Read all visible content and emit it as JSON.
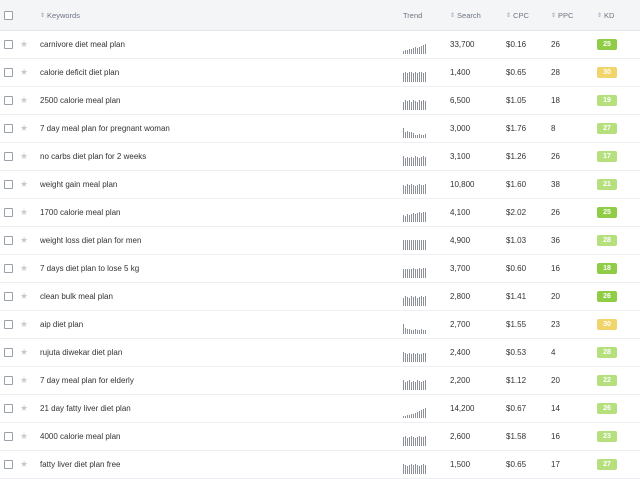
{
  "header": {
    "keywords": "Keywords",
    "trend": "Trend",
    "search": "Search",
    "cpc": "CPC",
    "ppc": "PPC",
    "kd": "KD"
  },
  "rows": [
    {
      "keyword": "carnivore diet meal plan",
      "search": "33,700",
      "cpc": "$0.16",
      "ppc": "26",
      "kd": "25",
      "kd_class": "easy",
      "trend": [
        3,
        4,
        4,
        5,
        5,
        6,
        7,
        6,
        7,
        8,
        9,
        10
      ]
    },
    {
      "keyword": "calorie deficit diet plan",
      "search": "1,400",
      "cpc": "$0.65",
      "ppc": "28",
      "kd": "30",
      "kd_class": "mid",
      "trend": [
        9,
        10,
        9,
        10,
        10,
        9,
        10,
        9,
        10,
        10,
        9,
        10
      ]
    },
    {
      "keyword": "2500 calorie meal plan",
      "search": "6,500",
      "cpc": "$1.05",
      "ppc": "18",
      "kd": "19",
      "kd_class": "light",
      "trend": [
        8,
        10,
        9,
        10,
        8,
        10,
        9,
        8,
        10,
        9,
        10,
        9
      ]
    },
    {
      "keyword": "7 day meal plan for pregnant woman",
      "search": "3,000",
      "cpc": "$1.76",
      "ppc": "8",
      "kd": "27",
      "kd_class": "light",
      "trend": [
        10,
        6,
        7,
        6,
        6,
        5,
        3,
        3,
        4,
        3,
        3,
        4
      ]
    },
    {
      "keyword": "no carbs diet plan for 2 weeks",
      "search": "3,100",
      "cpc": "$1.26",
      "ppc": "26",
      "kd": "17",
      "kd_class": "light",
      "trend": [
        10,
        8,
        9,
        8,
        9,
        8,
        10,
        9,
        8,
        9,
        10,
        9
      ]
    },
    {
      "keyword": "weight gain meal plan",
      "search": "10,800",
      "cpc": "$1.60",
      "ppc": "38",
      "kd": "21",
      "kd_class": "light",
      "trend": [
        9,
        8,
        10,
        9,
        10,
        9,
        8,
        9,
        10,
        9,
        9,
        10
      ]
    },
    {
      "keyword": "1700 calorie meal plan",
      "search": "4,100",
      "cpc": "$2.02",
      "ppc": "26",
      "kd": "25",
      "kd_class": "easy",
      "trend": [
        7,
        6,
        8,
        7,
        8,
        9,
        8,
        9,
        10,
        9,
        10,
        10
      ]
    },
    {
      "keyword": "weight loss diet plan for men",
      "search": "4,900",
      "cpc": "$1.03",
      "ppc": "36",
      "kd": "28",
      "kd_class": "light",
      "trend": [
        10,
        10,
        10,
        10,
        10,
        10,
        10,
        10,
        10,
        10,
        10,
        10
      ]
    },
    {
      "keyword": "7 days diet plan to lose 5 kg",
      "search": "3,700",
      "cpc": "$0.60",
      "ppc": "16",
      "kd": "18",
      "kd_class": "easy",
      "trend": [
        9,
        9,
        9,
        9,
        9,
        10,
        9,
        9,
        10,
        9,
        10,
        10
      ]
    },
    {
      "keyword": "clean bulk meal plan",
      "search": "2,800",
      "cpc": "$1.41",
      "ppc": "20",
      "kd": "26",
      "kd_class": "easy",
      "trend": [
        8,
        10,
        9,
        8,
        10,
        9,
        10,
        8,
        9,
        10,
        9,
        10
      ]
    },
    {
      "keyword": "aip diet plan",
      "search": "2,700",
      "cpc": "$1.55",
      "ppc": "23",
      "kd": "30",
      "kd_class": "mid",
      "trend": [
        10,
        6,
        5,
        5,
        4,
        4,
        5,
        4,
        4,
        5,
        4,
        4
      ]
    },
    {
      "keyword": "rujuta diwekar diet plan",
      "search": "2,400",
      "cpc": "$0.53",
      "ppc": "4",
      "kd": "28",
      "kd_class": "light",
      "trend": [
        10,
        9,
        8,
        9,
        8,
        9,
        8,
        9,
        8,
        8,
        9,
        9
      ]
    },
    {
      "keyword": "7 day meal plan for elderly",
      "search": "2,200",
      "cpc": "$1.12",
      "ppc": "20",
      "kd": "22",
      "kd_class": "light",
      "trend": [
        10,
        8,
        9,
        10,
        8,
        9,
        8,
        10,
        9,
        8,
        9,
        10
      ]
    },
    {
      "keyword": "21 day fatty liver diet plan",
      "search": "14,200",
      "cpc": "$0.67",
      "ppc": "14",
      "kd": "26",
      "kd_class": "light",
      "trend": [
        2,
        2,
        3,
        3,
        4,
        4,
        5,
        6,
        7,
        8,
        9,
        10
      ]
    },
    {
      "keyword": "4000 calorie meal plan",
      "search": "2,600",
      "cpc": "$1.58",
      "ppc": "16",
      "kd": "23",
      "kd_class": "light",
      "trend": [
        9,
        10,
        8,
        9,
        10,
        9,
        8,
        9,
        10,
        9,
        9,
        10
      ]
    },
    {
      "keyword": "fatty liver diet plan free",
      "search": "1,500",
      "cpc": "$0.65",
      "ppc": "17",
      "kd": "27",
      "kd_class": "light",
      "trend": [
        10,
        9,
        8,
        9,
        10,
        9,
        10,
        9,
        8,
        9,
        10,
        9
      ]
    }
  ]
}
